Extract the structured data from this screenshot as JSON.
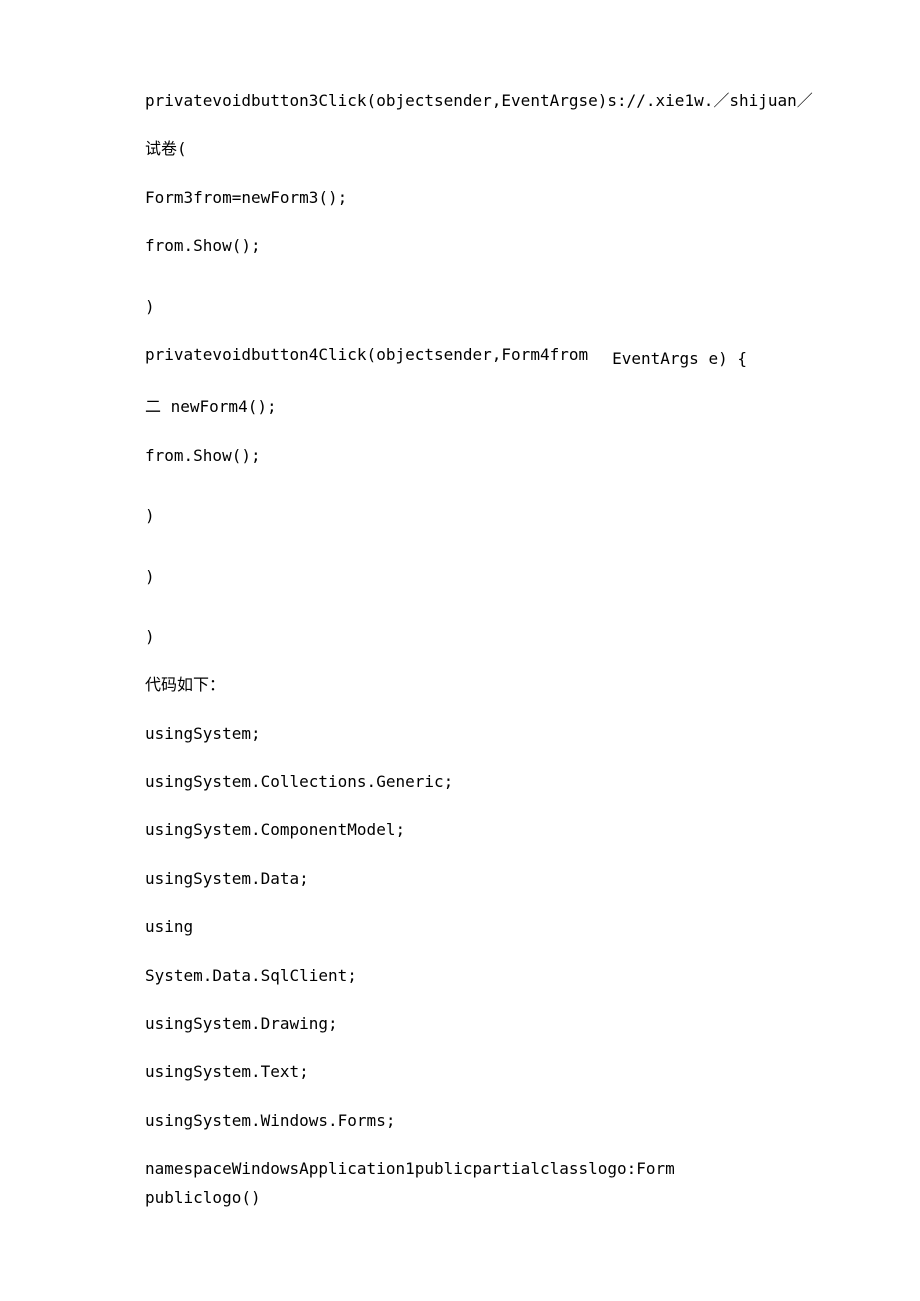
{
  "lines": {
    "l1": "privatevoidbutton3Click(objectsender,EventArgse)s://.xie1w.／shijuan／",
    "l2": "试卷(",
    "l3": "Form3from=newForm3();",
    "l4": "from.Show();",
    "l5": ")",
    "l6a": "privatevoidbutton4Click(objectsender,Form4from",
    "l6b": "EventArgs e) {",
    "l7": "二 newForm4();",
    "l8": "from.Show();",
    "l9": ")",
    "l10": ")",
    "l11": ")",
    "l12": "代码如下：",
    "l13": "usingSystem;",
    "l14": "usingSystem.Collections.Generic;",
    "l15": "usingSystem.ComponentModel;",
    "l16": "usingSystem.Data;",
    "l17": "using",
    "l18": "System.Data.SqlClient;",
    "l19": "usingSystem.Drawing;",
    "l20": "usingSystem.Text;",
    "l21": "usingSystem.Windows.Forms;",
    "l22": "namespaceWindowsApplication1publicpartialclasslogo:Form",
    "l23": "publiclogo()"
  }
}
